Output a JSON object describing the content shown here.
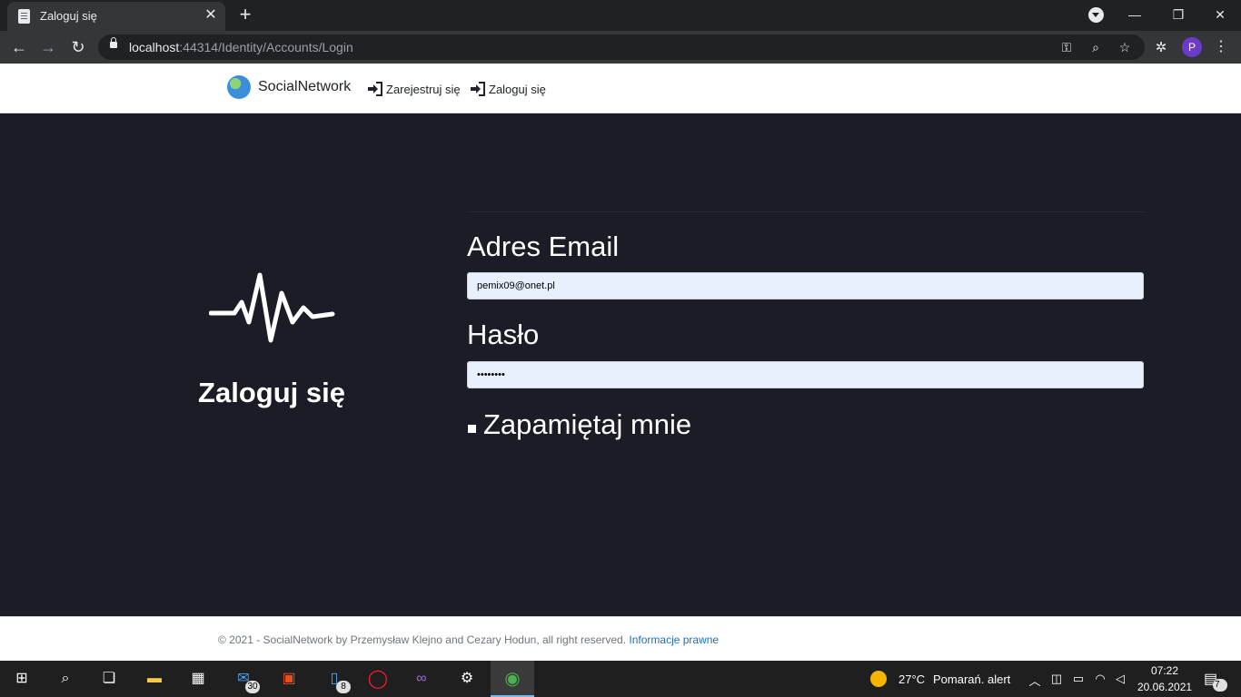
{
  "browser": {
    "tab_title": "Zaloguj się",
    "url_host": "localhost",
    "url_rest": ":44314/Identity/Accounts/Login",
    "profile_initial": "P"
  },
  "site": {
    "brand": "SocialNetwork",
    "nav_register": "Zarejestruj się",
    "nav_login": "Zaloguj się"
  },
  "login": {
    "heading": "Zaloguj się",
    "email_label": "Adres Email",
    "email_value": "pemix09@onet.pl",
    "password_label": "Hasło",
    "password_value": "••••••••",
    "remember_label": "Zapamiętaj mnie"
  },
  "footer": {
    "text": "© 2021 - SocialNetwork by Przemysław Klejno and Cezary Hodun, all right reserved.",
    "link": "Informacje prawne"
  },
  "taskbar": {
    "mail_badge": "30",
    "phone_badge": "8",
    "weather_temp": "27°C",
    "weather_alert": "Pomarań. alert",
    "time": "07:22",
    "date": "20.06.2021",
    "notifications_badge": "7"
  },
  "colors": {
    "page_bg": "#1b1c26",
    "link": "#1b6ec2",
    "input_bg": "#e8f0fe"
  }
}
